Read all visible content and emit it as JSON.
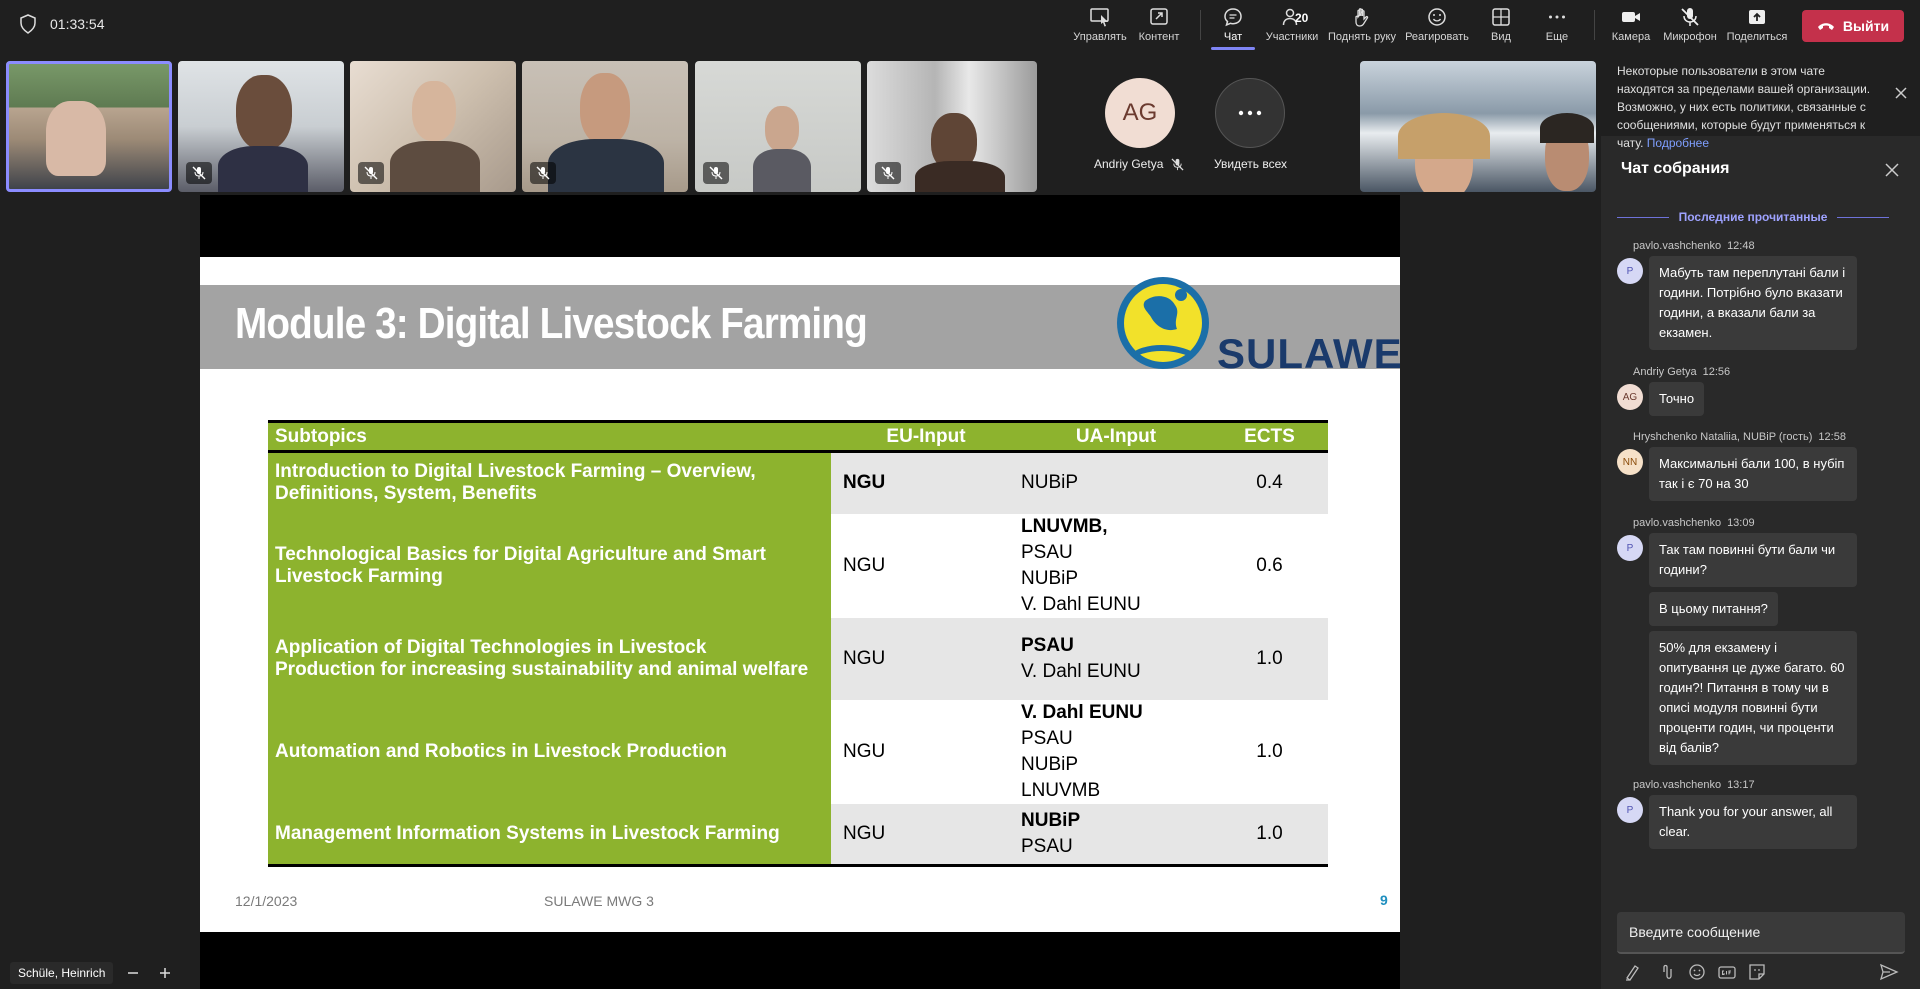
{
  "meeting": {
    "timer": "01:33:54"
  },
  "toolbar": {
    "control_label": "Управлять",
    "content_label": "Контент",
    "chat_label": "Чат",
    "participants_label": "Участники",
    "participants_count": "20",
    "raise_hand_label": "Поднять руку",
    "react_label": "Реагировать",
    "view_label": "Вид",
    "more_label": "Еще",
    "camera_label": "Камера",
    "mic_label": "Микрофон",
    "share_label": "Поделиться",
    "leave_label": "Выйти"
  },
  "participants": {
    "andriy_initials": "AG",
    "andriy_name": "Andriy Getya",
    "see_all_label": "Увидеть всех"
  },
  "slide": {
    "title": "Module 3: Digital Livestock Farming",
    "logo_text": "SULAWE",
    "table": {
      "headers": [
        "Subtopics",
        "EU-Input",
        "UA-Input",
        "ECTS"
      ],
      "rows": [
        {
          "subtopic": "Introduction to Digital Livestock Farming – Overview, Definitions, System, Benefits",
          "eu": "NGU",
          "ua_bold": "",
          "ua": "NUBiP",
          "ects": "0.4"
        },
        {
          "subtopic": "Technological Basics for Digital Agriculture and Smart Livestock Farming",
          "eu": "NGU",
          "ua_bold": "LNUVMB,",
          "ua": "PSAU\nNUBiP\nV. Dahl EUNU",
          "ects": "0.6"
        },
        {
          "subtopic": "Application of Digital Technologies in Livestock Production for increasing sustainability and animal welfare",
          "eu": "NGU",
          "ua_bold": "PSAU",
          "ua": "V. Dahl EUNU",
          "ects": "1.0"
        },
        {
          "subtopic": "Automation and Robotics in Livestock Production",
          "eu": "NGU",
          "ua_bold": "V. Dahl EUNU",
          "ua": "PSAU\nNUBiP\nLNUVMB",
          "ects": "1.0"
        },
        {
          "subtopic": "Management Information Systems in Livestock Farming",
          "eu": "NGU",
          "ua_bold": "NUBiP",
          "ua": "PSAU",
          "ects": "1.0"
        }
      ]
    },
    "footer_date": "12/1/2023",
    "footer_mid": "SULAWE MWG 3",
    "page_number": "9"
  },
  "presenter": {
    "name": "Schüle, Heinrich"
  },
  "chat": {
    "policy_text": "Некоторые пользователи в этом чате находятся за пределами вашей организации. Возможно, у них есть политики, связанные с сообщениями, которые будут применяться к чату.",
    "policy_link": "Подробнее",
    "title": "Чат собрания",
    "last_read_label": "Последние прочитанные",
    "messages": [
      {
        "author": "pavlo.vashchenko",
        "time": "12:48",
        "initials": "P",
        "text": "Мабуть там переплутані бали і години. Потрібно було вказати години, а вказали бали за екзамен."
      },
      {
        "author": "Andriy Getya",
        "time": "12:56",
        "initials": "AG",
        "text": "Точно"
      },
      {
        "author": "Hryshchenko Nataliia, NUBiP (гость)",
        "time": "12:58",
        "initials": "NN",
        "text": "Максимальні бали 100, в нубіп так і є 70 на 30"
      },
      {
        "author": "pavlo.vashchenko",
        "time": "13:09",
        "initials": "P",
        "text": "Так там повинні бути бали чи години?"
      },
      {
        "author": "",
        "time": "",
        "initials": "",
        "text": "В цьому питання?"
      },
      {
        "author": "",
        "time": "",
        "initials": "",
        "text": "50% для екзамену і опитування це дуже багато. 60 годин?! Питання в тому чи в описі модуля повинні бути проценти годин, чи проценти від балів?"
      },
      {
        "author": "pavlo.vashchenko",
        "time": "13:17",
        "initials": "P",
        "text": "Thank you for your answer, all clear."
      }
    ],
    "compose_placeholder": "Введите сообщение"
  },
  "colors": {
    "accent": "#7f85f5",
    "leave": "#c4314b",
    "slide_green": "#8db32e"
  }
}
